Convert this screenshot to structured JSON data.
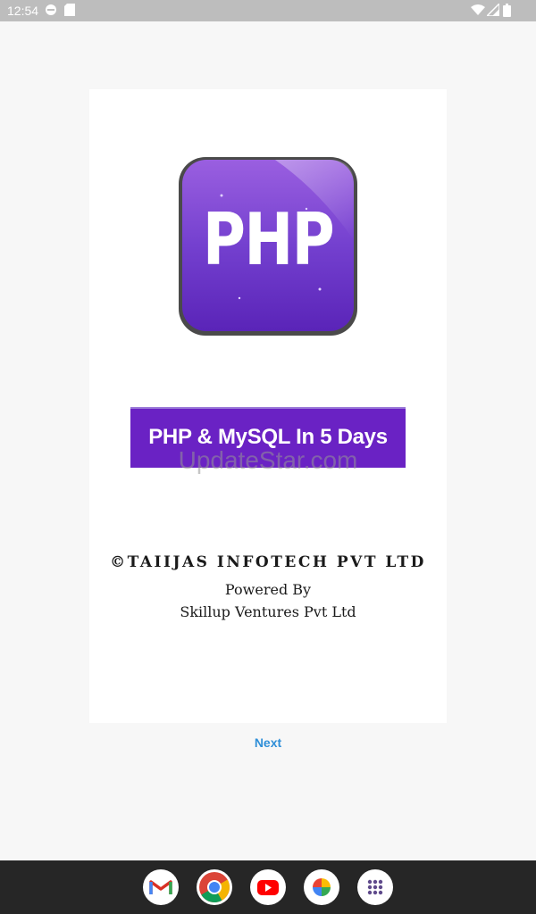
{
  "status": {
    "time": "12:54"
  },
  "logo": {
    "text": "PHP"
  },
  "banner": {
    "title": "PHP & MySQL In 5 Days",
    "watermark": "UpdateStar.com"
  },
  "credits": {
    "copyright": "©TAIIJAS INFOTECH PVT LTD",
    "powered_by": "Powered By",
    "company": "Skillup Ventures Pvt Ltd"
  },
  "actions": {
    "next_label": "Next"
  },
  "dock": [
    {
      "name": "gmail-icon"
    },
    {
      "name": "chrome-icon"
    },
    {
      "name": "youtube-icon"
    },
    {
      "name": "photos-icon"
    },
    {
      "name": "app-drawer-icon"
    }
  ],
  "colors": {
    "accent": "#2f8fd8",
    "banner": "#6a22c4",
    "logo": "#7a3fd0"
  }
}
